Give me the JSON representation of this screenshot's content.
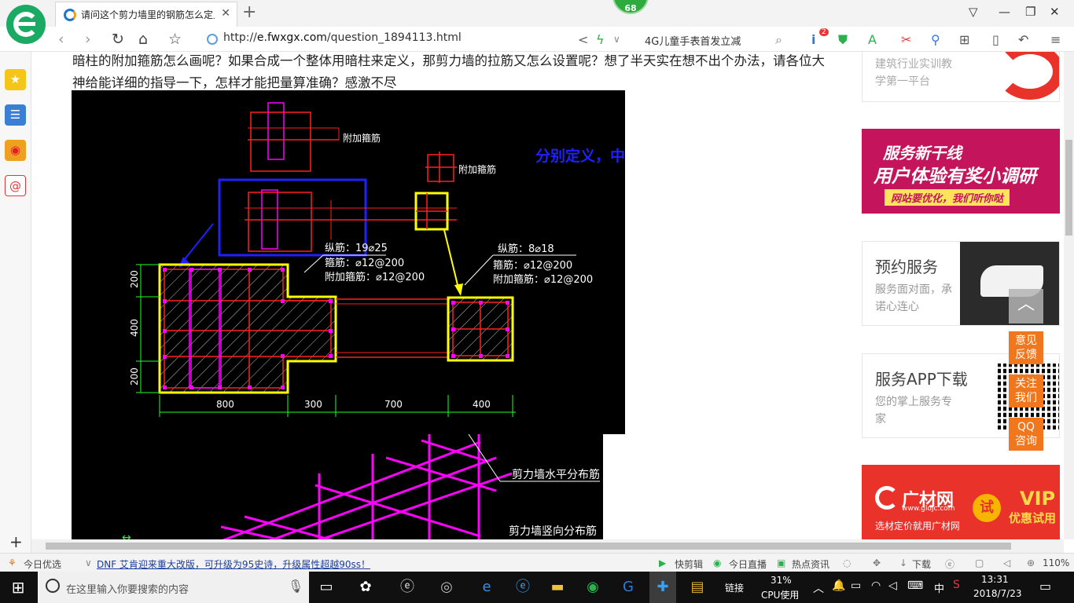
{
  "browser": {
    "tab_title": "请问这个剪力墙里的钢筋怎么定义",
    "badge": "68",
    "url_prefix": "http://",
    "url_host": "e.fwxgx.com",
    "url_path": "/question_1894113.html",
    "search_text": "4G儿童手表首发立减",
    "ext_badge": "2"
  },
  "page": {
    "question_text": "暗柱的附加箍筋怎么画呢？如果合成一个整体用暗柱来定义，那剪力墙的拉筋又怎么设置呢？想了半天实在想不出个办法，请各位大神给能详细的指导一下，怎样才能把量算准确？感激不尽"
  },
  "drawing": {
    "label_extra_stirrup": "附加箍筋",
    "label_extra_stirrup_2": "附加箍筋",
    "note_blue": "分别定义，中间定义剪力墙",
    "left_long": "纵筋：19⌀25",
    "left_stirrup": "箍筋：⌀12@200",
    "left_extra": "附加箍筋：⌀12@200",
    "right_long": "纵筋：8⌀18",
    "right_stirrup": "箍筋：⌀12@200",
    "right_extra": "附加箍筋：⌀12@200",
    "dim_v1": "200",
    "dim_v2": "400",
    "dim_v3": "200",
    "dim_h1": "800",
    "dim_h2": "300",
    "dim_h3": "700",
    "dim_h4": "400",
    "wall_horiz": "剪力墙水平分布筋",
    "wall_vert": "剪力墙竖向分布筋"
  },
  "sidebar": {
    "card1_line1": "建筑行业实训教",
    "card1_line2": "学第一平台",
    "banner1_title": "服务新干线",
    "banner1_main": "用户体验有奖小调研",
    "banner1_sub": "网站要优化，我们听你哒",
    "card2_title": "预约服务",
    "card2_line1": "服务面对面，承",
    "card2_line2": "诺心连心",
    "card3_title": "服务APP下载",
    "card3_line1": "您的掌上服务专",
    "card3_line2": "家",
    "banner2_brand": "广材网",
    "banner2_url": "www.gldjc.com",
    "banner2_slogan": "选材定价就用广材网",
    "banner2_try": "试",
    "banner2_vip": "VIP",
    "banner2_vip_sub": "优惠试用"
  },
  "float_buttons": {
    "feedback_1": "意见",
    "feedback_2": "反馈",
    "follow_1": "关注",
    "follow_2": "我们",
    "qq_1": "QQ",
    "qq_2": "咨询"
  },
  "statusbar": {
    "today_pick": "今日优选",
    "headline": "DNF 艾肯迎来重大改版，可升级为95史诗，升级属性超越90ss！",
    "quick_cut": "快剪辑",
    "today_live": "今日直播",
    "hot_news": "热点资讯",
    "download": "下载",
    "zoom": "110%"
  },
  "taskbar": {
    "search_placeholder": "在这里输入你要搜索的内容",
    "links": "链接",
    "cpu_percent": "31%",
    "cpu_label": "CPU使用",
    "ime": "中",
    "time": "13:31",
    "date": "2018/7/23"
  },
  "colors": {
    "browser_green": "#1aaa63",
    "accent_orange": "#f0771e",
    "cad_yellow": "#ffff00",
    "cad_magenta": "#ff00ff",
    "cad_red": "#ff2020",
    "cad_blue": "#2020ff"
  }
}
